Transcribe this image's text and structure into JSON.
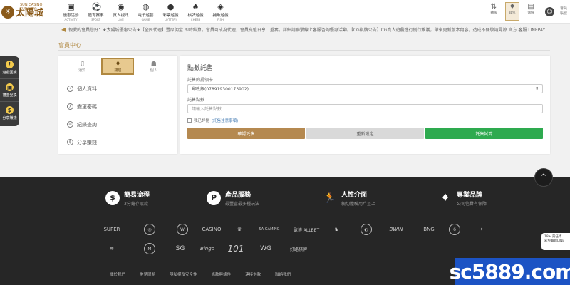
{
  "logo": {
    "name": "太陽城",
    "tagline": "SUN CASINO SUNCITY"
  },
  "nav": [
    {
      "label": "優惠活動",
      "sub": "ACTIVITY",
      "icon": "gift-icon"
    },
    {
      "label": "體育賽事",
      "sub": "SPORT",
      "icon": "ball-icon"
    },
    {
      "label": "真人視訊",
      "sub": "LIVE",
      "icon": "chip-icon"
    },
    {
      "label": "電子遊藝",
      "sub": "GAME",
      "icon": "gamepad-icon"
    },
    {
      "label": "彩票遊戲",
      "sub": "LOTTERY",
      "icon": "lottery-icon"
    },
    {
      "label": "棋牌遊戲",
      "sub": "CHESS",
      "icon": "cards-icon"
    },
    {
      "label": "捕魚遊戲",
      "sub": "FISH",
      "icon": "fish-icon"
    }
  ],
  "topright": [
    {
      "label": "轉帳",
      "icon": "transfer-icon"
    },
    {
      "label": "錢包",
      "icon": "wallet-icon"
    },
    {
      "label": "儲值",
      "icon": "vip-icon"
    }
  ],
  "user": {
    "line1": "會員",
    "line2": "帳號"
  },
  "marquee": "親愛的會員您好：★太陽城優惠公告★【全民代理】豐厚佣金 即時結算，會員可成為代理，會員充值日享二重奏，詳細請聯繫線上客服咨詢優惠活動。【CG棋牌公告】CG真人遊戲進行例行維護，帶來更新版本內容，造成不便敬請見諒 官方 客服 LINEPAY",
  "floattabs": [
    {
      "label": "遊戲回饋",
      "icon": "!"
    },
    {
      "label": "禮金兌換",
      "icon": "▣"
    },
    {
      "label": "分享賺錢",
      "icon": "$"
    }
  ],
  "page": {
    "title": "會員中心"
  },
  "sidetabs": [
    {
      "label": "通知",
      "icon": "bell-icon",
      "active": false
    },
    {
      "label": "錢包",
      "icon": "diamond-icon",
      "active": true
    },
    {
      "label": "個人",
      "icon": "user-icon",
      "active": false
    }
  ],
  "sidemenu": [
    {
      "label": "個人資料",
      "icon": "person-icon"
    },
    {
      "label": "變更密碼",
      "icon": "key-icon"
    },
    {
      "label": "紀錄查詢",
      "icon": "record-icon"
    },
    {
      "label": "分享賺錢",
      "icon": "share-icon"
    }
  ],
  "form": {
    "title": "點數託售",
    "select_label": "託售的提領卡",
    "select_value": "郵政銀(078919300173902)",
    "amount_label": "託售點數",
    "amount_placeholder": "請輸入託售點數",
    "agree_text": "我已詳閱",
    "agree_link": "(託售注意事項)",
    "submit_label": "確認託售",
    "reset_label": "重新設定",
    "trial_label": "託售試算"
  },
  "features": [
    {
      "title": "簡易流程",
      "sub": "3分鐘存取款",
      "icon": "$"
    },
    {
      "title": "產品服務",
      "sub": "最豐富最多種玩法",
      "icon": "P"
    },
    {
      "title": "人性介面",
      "sub": "親切體驗用戶至上",
      "icon": "🏃"
    },
    {
      "title": "專業品牌",
      "sub": "公司信譽有保障",
      "icon": "♦"
    }
  ],
  "brands_row1": [
    "SUPER",
    "◎",
    "W",
    "CASINO",
    "♛",
    "SA GAMING",
    "歐博 ALLBET",
    "♞",
    "◐",
    "BWIN",
    "BNG",
    "6",
    "✦"
  ],
  "brands_row2": [
    "≋",
    "M",
    "SG",
    "Bingo",
    "101",
    "WG",
    "好路棋牌"
  ],
  "footer_links": [
    "關於我們",
    "常見問題",
    "隱私權及安全性",
    "條款與條件",
    "連接供款",
    "聯絡我們"
  ],
  "side_popup": {
    "line1": "18+ 責任博",
    "line2": "彩免費贈LINE"
  },
  "watermark": "sc5889.com",
  "back_to_top": "^"
}
